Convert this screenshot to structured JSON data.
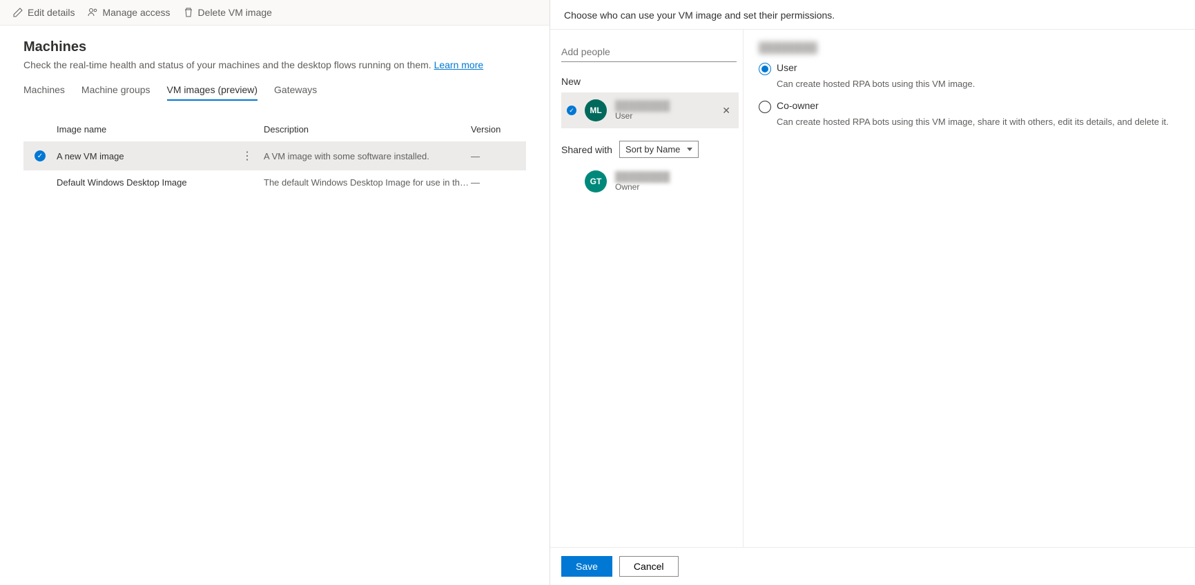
{
  "toolbar": {
    "edit": "Edit details",
    "manage": "Manage access",
    "delete": "Delete VM image"
  },
  "page": {
    "title": "Machines",
    "desc_prefix": "Check the real-time health and status of your machines and the desktop flows running on them. ",
    "learn_more": "Learn more"
  },
  "tabs": {
    "machines": "Machines",
    "groups": "Machine groups",
    "vmimages": "VM images (preview)",
    "gateways": "Gateways"
  },
  "table": {
    "headers": {
      "name": "Image name",
      "desc": "Description",
      "version": "Version"
    },
    "rows": [
      {
        "selected": true,
        "name": "A new VM image",
        "desc": "A VM image with some software installed.",
        "version": "—"
      },
      {
        "selected": false,
        "name": "Default Windows Desktop Image",
        "desc": "The default Windows Desktop Image for use in the Product ...",
        "version": "—"
      }
    ]
  },
  "panel": {
    "description": "Choose who can use your VM image and set their permissions.",
    "add_placeholder": "Add people",
    "new_label": "New",
    "shared_label": "Shared with",
    "sort_label": "Sort by Name",
    "new_people": [
      {
        "initials": "ML",
        "name_blur": "████████",
        "role": "User"
      }
    ],
    "shared_people": [
      {
        "initials": "GT",
        "name_blur": "████████",
        "role": "Owner"
      }
    ],
    "perm_title_blur": "████████",
    "perms": {
      "user": {
        "label": "User",
        "desc": "Can create hosted RPA bots using this VM image."
      },
      "coowner": {
        "label": "Co-owner",
        "desc": "Can create hosted RPA bots using this VM image, share it with others, edit its details, and delete it."
      }
    },
    "save": "Save",
    "cancel": "Cancel"
  }
}
